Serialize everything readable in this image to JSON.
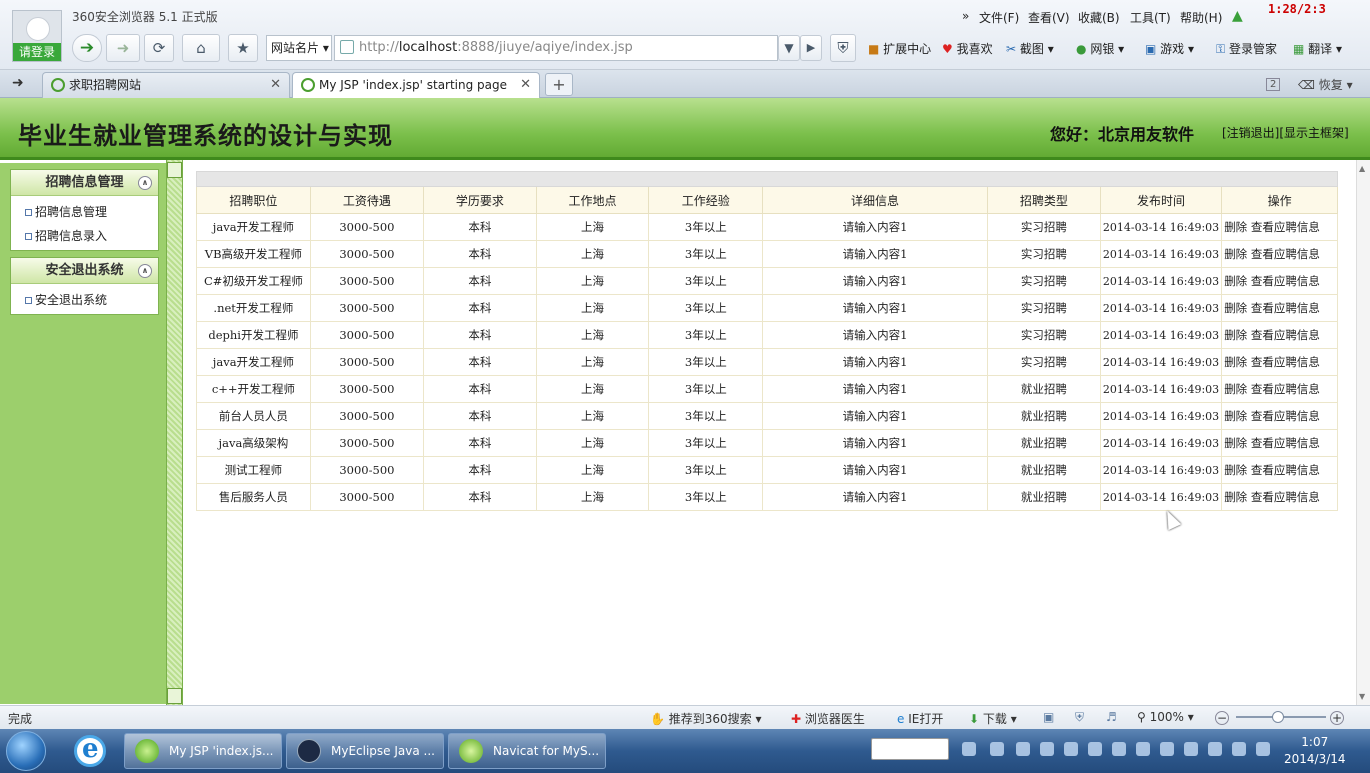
{
  "browser": {
    "app_title": "360安全浏览器 5.1 正式版",
    "login_label": "请登录",
    "menus": [
      "文件(F)",
      "查看(V)",
      "收藏(B)",
      "工具(T)",
      "帮助(H)"
    ],
    "menu_more": "»",
    "recording_time": "1:28/2:3",
    "site_card": "网站名片",
    "address_prefix": "http://",
    "address_host": "localhost",
    "address_rest": ":8888/jiuye/aqiye/index.jsp",
    "toolbar_items": [
      "扩展中心",
      "我喜欢",
      "截图",
      "网银",
      "游戏",
      "登录管家",
      "翻译"
    ],
    "tabs": [
      {
        "label": "求职招聘网站"
      },
      {
        "label": "My JSP 'index.jsp' starting page"
      }
    ],
    "restore_label": "恢复",
    "tab_count": "2"
  },
  "page": {
    "title": "毕业生就业管理系统的设计与实现",
    "greeting": "您好：北京用友软件",
    "logout_link": "[注销退出]",
    "show_frame_link": "[显示主框架]"
  },
  "sidebar": {
    "panels": [
      {
        "title": "招聘信息管理",
        "items": [
          "招聘信息管理",
          "招聘信息录入"
        ]
      },
      {
        "title": "安全退出系统",
        "items": [
          "安全退出系统"
        ]
      }
    ]
  },
  "table": {
    "columns": [
      "招聘职位",
      "工资待遇",
      "学历要求",
      "工作地点",
      "工作经验",
      "详细信息",
      "招聘类型",
      "发布时间",
      "操作"
    ],
    "delete_label": "删除",
    "view_label": "查看应聘信息",
    "rows": [
      [
        "java开发工程师",
        "3000-500",
        "本科",
        "上海",
        "3年以上",
        "请输入内容1",
        "实习招聘",
        "2014-03-14 16:49:03"
      ],
      [
        "VB高级开发工程师",
        "3000-500",
        "本科",
        "上海",
        "3年以上",
        "请输入内容1",
        "实习招聘",
        "2014-03-14 16:49:03"
      ],
      [
        "C#初级开发工程师",
        "3000-500",
        "本科",
        "上海",
        "3年以上",
        "请输入内容1",
        "实习招聘",
        "2014-03-14 16:49:03"
      ],
      [
        ".net开发工程师",
        "3000-500",
        "本科",
        "上海",
        "3年以上",
        "请输入内容1",
        "实习招聘",
        "2014-03-14 16:49:03"
      ],
      [
        "dephi开发工程师",
        "3000-500",
        "本科",
        "上海",
        "3年以上",
        "请输入内容1",
        "实习招聘",
        "2014-03-14 16:49:03"
      ],
      [
        "java开发工程师",
        "3000-500",
        "本科",
        "上海",
        "3年以上",
        "请输入内容1",
        "实习招聘",
        "2014-03-14 16:49:03"
      ],
      [
        "c++开发工程师",
        "3000-500",
        "本科",
        "上海",
        "3年以上",
        "请输入内容1",
        "就业招聘",
        "2014-03-14 16:49:03"
      ],
      [
        "前台人员人员",
        "3000-500",
        "本科",
        "上海",
        "3年以上",
        "请输入内容1",
        "就业招聘",
        "2014-03-14 16:49:03"
      ],
      [
        "java高级架构",
        "3000-500",
        "本科",
        "上海",
        "3年以上",
        "请输入内容1",
        "就业招聘",
        "2014-03-14 16:49:03"
      ],
      [
        "测试工程师",
        "3000-500",
        "本科",
        "上海",
        "3年以上",
        "请输入内容1",
        "就业招聘",
        "2014-03-14 16:49:03"
      ],
      [
        "售后服务人员",
        "3000-500",
        "本科",
        "上海",
        "3年以上",
        "请输入内容1",
        "就业招聘",
        "2014-03-14 16:49:03"
      ]
    ]
  },
  "statusbar": {
    "status": "完成",
    "items": [
      "推荐到360搜索",
      "浏览器医生",
      "IE打开",
      "下载"
    ],
    "zoom": "100%"
  },
  "taskbar": {
    "windows": [
      "My JSP 'index.js...",
      "MyEclipse Java ...",
      "Navicat for MyS..."
    ],
    "time": "1:07",
    "date": "2014/3/14"
  }
}
